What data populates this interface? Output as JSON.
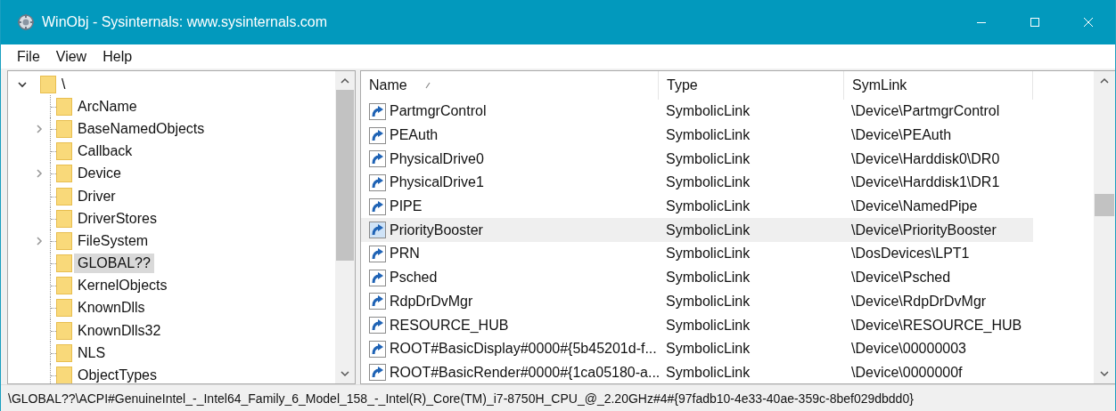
{
  "window": {
    "title": "WinObj - Sysinternals: www.sysinternals.com"
  },
  "menu": [
    "File",
    "View",
    "Help"
  ],
  "tree": {
    "label": "\\",
    "expanded": true,
    "selected": false,
    "children": [
      {
        "label": "ArcName",
        "expandable": false,
        "selected": false
      },
      {
        "label": "BaseNamedObjects",
        "expandable": true,
        "selected": false
      },
      {
        "label": "Callback",
        "expandable": false,
        "selected": false
      },
      {
        "label": "Device",
        "expandable": true,
        "selected": false
      },
      {
        "label": "Driver",
        "expandable": false,
        "selected": false
      },
      {
        "label": "DriverStores",
        "expandable": false,
        "selected": false
      },
      {
        "label": "FileSystem",
        "expandable": true,
        "selected": false
      },
      {
        "label": "GLOBAL??",
        "expandable": false,
        "selected": true
      },
      {
        "label": "KernelObjects",
        "expandable": false,
        "selected": false
      },
      {
        "label": "KnownDlls",
        "expandable": false,
        "selected": false
      },
      {
        "label": "KnownDlls32",
        "expandable": false,
        "selected": false
      },
      {
        "label": "NLS",
        "expandable": false,
        "selected": false
      },
      {
        "label": "ObjectTypes",
        "expandable": false,
        "selected": false
      }
    ]
  },
  "table": {
    "columns": [
      {
        "label": "Name",
        "sorted": true
      },
      {
        "label": "Type",
        "sorted": false
      },
      {
        "label": "SymLink",
        "sorted": false
      }
    ],
    "rows": [
      {
        "name": "PartmgrControl",
        "type": "SymbolicLink",
        "symlink": "\\Device\\PartmgrControl",
        "selected": false
      },
      {
        "name": "PEAuth",
        "type": "SymbolicLink",
        "symlink": "\\Device\\PEAuth",
        "selected": false
      },
      {
        "name": "PhysicalDrive0",
        "type": "SymbolicLink",
        "symlink": "\\Device\\Harddisk0\\DR0",
        "selected": false
      },
      {
        "name": "PhysicalDrive1",
        "type": "SymbolicLink",
        "symlink": "\\Device\\Harddisk1\\DR1",
        "selected": false
      },
      {
        "name": "PIPE",
        "type": "SymbolicLink",
        "symlink": "\\Device\\NamedPipe",
        "selected": false
      },
      {
        "name": "PriorityBooster",
        "type": "SymbolicLink",
        "symlink": "\\Device\\PriorityBooster",
        "selected": true
      },
      {
        "name": "PRN",
        "type": "SymbolicLink",
        "symlink": "\\DosDevices\\LPT1",
        "selected": false
      },
      {
        "name": "Psched",
        "type": "SymbolicLink",
        "symlink": "\\Device\\Psched",
        "selected": false
      },
      {
        "name": "RdpDrDvMgr",
        "type": "SymbolicLink",
        "symlink": "\\Device\\RdpDrDvMgr",
        "selected": false
      },
      {
        "name": "RESOURCE_HUB",
        "type": "SymbolicLink",
        "symlink": "\\Device\\RESOURCE_HUB",
        "selected": false
      },
      {
        "name": "ROOT#BasicDisplay#0000#{5b45201d-f...",
        "type": "SymbolicLink",
        "symlink": "\\Device\\00000003",
        "selected": false
      },
      {
        "name": "ROOT#BasicRender#0000#{1ca05180-a...",
        "type": "SymbolicLink",
        "symlink": "\\Device\\0000000f",
        "selected": false
      }
    ]
  },
  "status_bar": "\\GLOBAL??\\ACPI#GenuineIntel_-_Intel64_Family_6_Model_158_-_Intel(R)_Core(TM)_i7-8750H_CPU_@_2.20GHz#4#{97fadb10-4e33-40ae-359c-8bef029dbdd0}"
}
